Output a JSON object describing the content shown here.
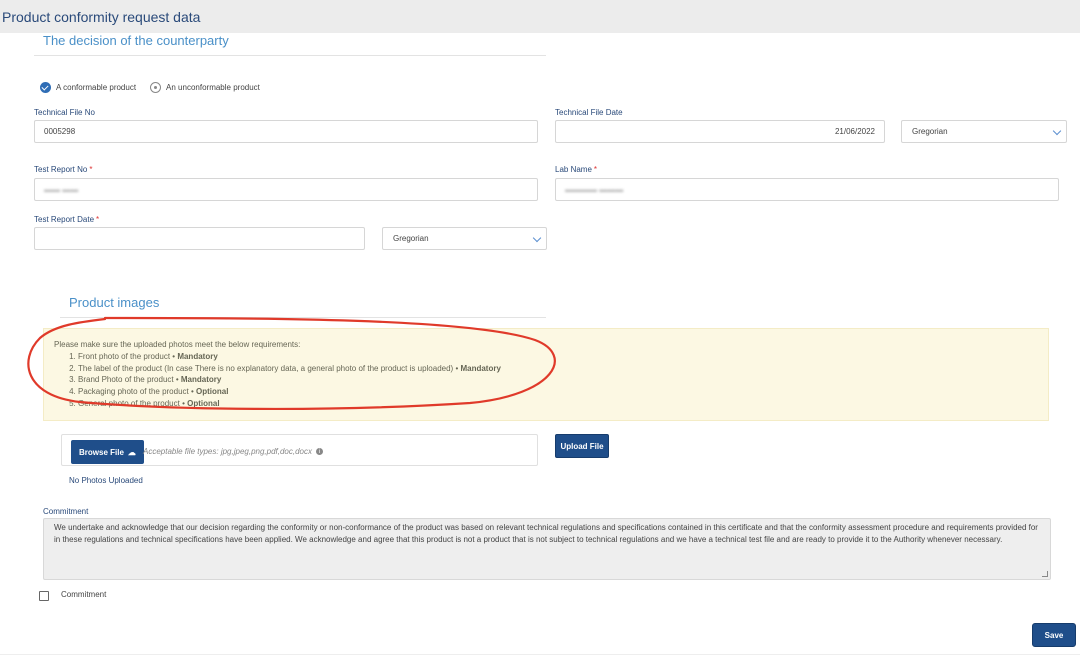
{
  "header": {
    "title": "Product conformity request data"
  },
  "decision": {
    "section_title": "The decision of the counterparty",
    "options": [
      {
        "label": "A conformable product",
        "selected": true
      },
      {
        "label": "An unconformable product",
        "selected": false
      }
    ]
  },
  "fields": {
    "technical_file_no": {
      "label": "Technical File No",
      "value": "0005298"
    },
    "technical_file_date": {
      "label": "Technical File Date",
      "value": "21/06/2022",
      "calendar": "Gregorian"
    },
    "test_report_no": {
      "label": "Test Report No",
      "required_mark": "*",
      "value": ""
    },
    "lab_name": {
      "label": "Lab Name",
      "required_mark": "*",
      "value": ""
    },
    "test_report_date": {
      "label": "Test Report Date",
      "required_mark": "*",
      "value": "",
      "calendar": "Gregorian"
    }
  },
  "images": {
    "section_title": "Product images",
    "note_intro": "Please make sure the uploaded photos meet the below requirements:",
    "requirements": [
      {
        "text": "Front photo of the product",
        "tag": "Mandatory"
      },
      {
        "text": "The label of the product (In case There is no explanatory data, a general photo of the product is uploaded)",
        "tag": "Mandatory"
      },
      {
        "text": "Brand Photo of the product",
        "tag": "Mandatory"
      },
      {
        "text": "Packaging photo of the product",
        "tag": "Optional"
      },
      {
        "text": "General photo of the product",
        "tag": "Optional"
      }
    ],
    "tag_separator": " • ",
    "browse_label": "Browse File",
    "accepted_types": "Acceptable file types: jpg,jpeg,png,pdf,doc,docx",
    "upload_label": "Upload File",
    "status": "No Photos Uploaded"
  },
  "commitment": {
    "label": "Commitment",
    "text": "We undertake and acknowledge that our decision regarding the conformity or non-conformance of the product was based on relevant technical regulations and specifications contained in this certificate and that the conformity assessment procedure and requirements provided for in these regulations and technical specifications have been applied. We acknowledge and agree that this product is not a product that is not subject to technical regulations and we have a technical test file and are ready to provide it to the Authority whenever necessary.",
    "checkbox_label": "Commitment",
    "checked": false
  },
  "actions": {
    "save_label": "Save"
  },
  "colors": {
    "accent": "#1f4e8a",
    "section_title": "#4a90c8",
    "note_bg": "#fcf8e3",
    "annotation": "#e03a2a"
  }
}
